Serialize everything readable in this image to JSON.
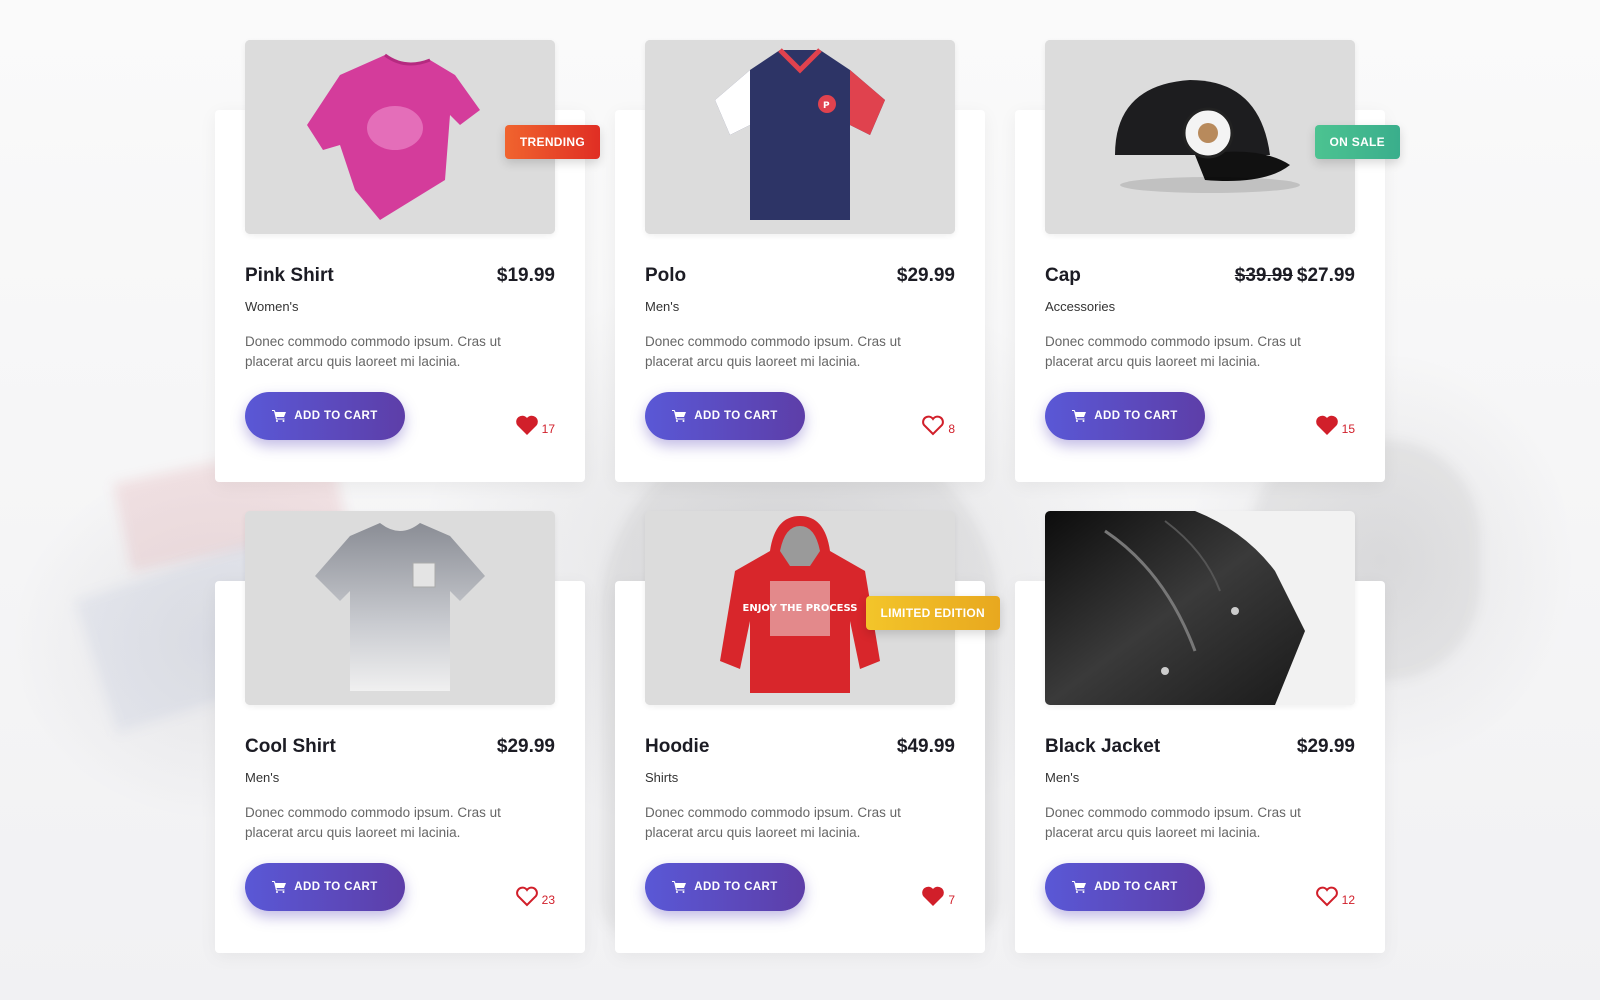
{
  "products": [
    {
      "name": "Pink Shirt",
      "price": "$19.99",
      "old_price": "",
      "category": "Women's",
      "description": "Donec commodo commodo ipsum. Cras ut placerat arcu quis laoreet mi lacinia.",
      "badge": {
        "label": "TRENDING",
        "color_start": "#f0642e",
        "color_end": "#e02e24"
      },
      "cart_label": "ADD TO CART",
      "likes": "17",
      "liked": true
    },
    {
      "name": "Polo",
      "price": "$29.99",
      "old_price": "",
      "category": "Men's",
      "description": "Donec commodo commodo ipsum. Cras ut placerat arcu quis laoreet mi lacinia.",
      "badge": null,
      "cart_label": "ADD TO CART",
      "likes": "8",
      "liked": false
    },
    {
      "name": "Cap",
      "price": "$27.99",
      "old_price": "$39.99",
      "category": "Accessories",
      "description": "Donec commodo commodo ipsum. Cras ut placerat arcu quis laoreet mi lacinia.",
      "badge": {
        "label": "ON SALE",
        "color_start": "#4cc391",
        "color_end": "#3aae8c"
      },
      "cart_label": "ADD TO CART",
      "likes": "15",
      "liked": true
    },
    {
      "name": "Cool Shirt",
      "price": "$29.99",
      "old_price": "",
      "category": "Men's",
      "description": "Donec commodo commodo ipsum. Cras ut placerat arcu quis laoreet mi lacinia.",
      "badge": null,
      "cart_label": "ADD TO CART",
      "likes": "23",
      "liked": false
    },
    {
      "name": "Hoodie",
      "price": "$49.99",
      "old_price": "",
      "category": "Shirts",
      "description": "Donec commodo commodo ipsum. Cras ut placerat arcu quis laoreet mi lacinia.",
      "badge": {
        "label": "LIMITED EDITION",
        "color_start": "#f3c52a",
        "color_end": "#e8a81f"
      },
      "cart_label": "ADD TO CART",
      "likes": "7",
      "liked": true
    },
    {
      "name": "Black Jacket",
      "price": "$29.99",
      "old_price": "",
      "category": "Men's",
      "description": "Donec commodo commodo ipsum. Cras ut placerat arcu quis laoreet mi lacinia.",
      "badge": null,
      "cart_label": "ADD TO CART",
      "likes": "12",
      "liked": false
    }
  ],
  "hoodie_print": "ENJOY THE PROCESS",
  "icons": {
    "cart": "cart-icon",
    "heart": "heart-icon"
  },
  "colors": {
    "accent_start": "#5a58d6",
    "accent_end": "#5d3ea8",
    "heart": "#d11f2a"
  }
}
